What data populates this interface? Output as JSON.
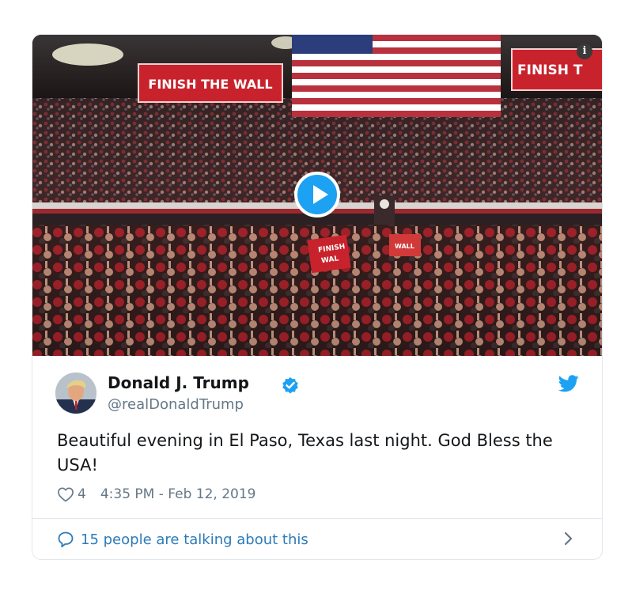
{
  "media": {
    "banner_left": "FINISH THE WALL",
    "banner_right": "FINISH T",
    "crowd_sign_1": "FINISH",
    "crowd_sign_1b": "WAL",
    "crowd_sign_2": "WALL",
    "info_glyph": "i",
    "play_icon": "play-icon"
  },
  "tweet": {
    "author_name": "Donald J. Trump",
    "handle": "@realDonaldTrump",
    "text": "Beautiful evening in El Paso, Texas last night. God Bless the USA!",
    "like_count": "4",
    "timestamp": "4:35 PM - Feb 12, 2019",
    "talking": "15 people are talking about this"
  },
  "colors": {
    "twitter_blue": "#1da1f2",
    "link_blue": "#2b7bb9",
    "muted": "#657786",
    "border": "#e1e8ed",
    "banner_red": "#c8232c"
  }
}
